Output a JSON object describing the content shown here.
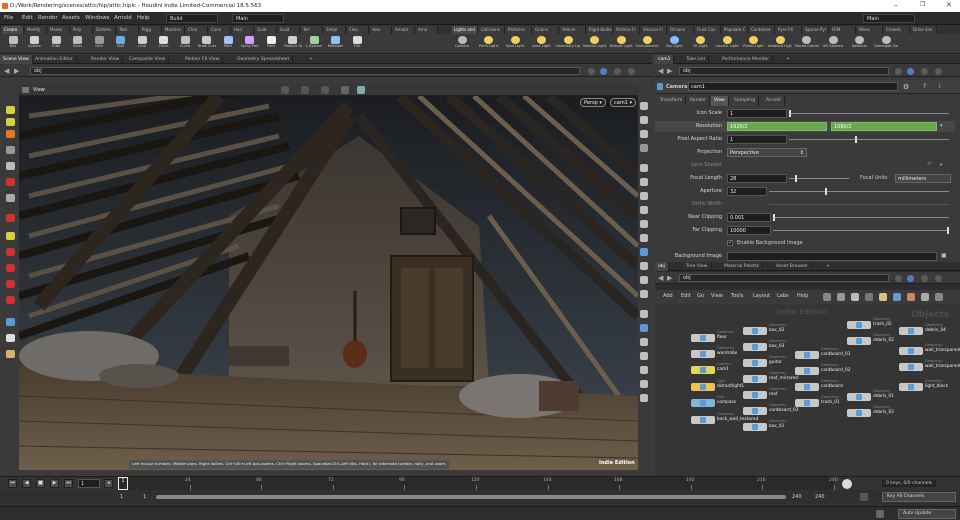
{
  "window": {
    "title": "D:/Work/Rendering/scenes/attic/hip/attic.hiplc - Houdini Indie Limited-Commercial 18.5.563"
  },
  "menu": {
    "items": [
      "File",
      "Edit",
      "Render",
      "Assets",
      "Windows",
      "Arnold",
      "Help"
    ],
    "build": "Build",
    "main_left": "Main",
    "main_right": "Main"
  },
  "shelf_tabs_left": [
    "Create",
    "Modify",
    "Model",
    "Poly",
    "Deform",
    "Text",
    "Rigg",
    "Muscles",
    "Char",
    "Cons",
    "Hair",
    "Guid",
    "Guid",
    "Terr",
    "Simpl",
    "Clou",
    "Volu",
    "Arnold",
    "Arno"
  ],
  "shelf_tabs_right": [
    "Lights and",
    "Collisions",
    "Particles",
    "Grains",
    "Vellum",
    "Rigid Bodies",
    "Particle Fl",
    "Viscous Fl",
    "Oceans",
    "Fluid Con",
    "Populate C",
    "Container",
    "Pyro FX",
    "Sparse Pyr",
    "FEM",
    "Wires",
    "Crowds",
    "Drive Sim"
  ],
  "tools_left": [
    "Box",
    "Sphere",
    "Tube",
    "Torus",
    "Grid",
    "Null",
    "Line",
    "Circle",
    "Curve",
    "Draw Curve",
    "Path",
    "Spray Paint",
    "Font",
    "Platonic Solids",
    "L-System",
    "Metaball",
    "File"
  ],
  "tools_right": [
    "Camera",
    "Point Light",
    "Spot Light",
    "Area Light",
    "Geometry Light",
    "Volume Light",
    "Distant Light",
    "Environment Light",
    "Sky Light",
    "GI Light",
    "Caustic Light",
    "Portal Light",
    "Ambient Light",
    "Stereo Camera",
    "VR Camera",
    "Switcher",
    "Gamepad Camera"
  ],
  "left_tabs": [
    "Scene View",
    "Animation Editor",
    "Render View",
    "Composite View",
    "Motion FX View",
    "Geometry Spreadsheet"
  ],
  "right_top_tabs": [
    "cam1",
    "Take List",
    "Performance Monitor"
  ],
  "right_bottom_tabs": [
    "obj",
    "Tree View",
    "Material Palette",
    "Asset Browser"
  ],
  "paths": {
    "viewport": "obj",
    "params": "obj",
    "network": "obj"
  },
  "viewport": {
    "label": "View",
    "persp": "Persp",
    "cam": "cam1",
    "hint": "Left mouse tumbles. Middle pans. Right dollies. Ctrl+Alt+Left box-zooms. Ctrl+Right zooms. Spacebar-Ctrl-Left tilts. Hold L for alternate tumble, dolly, and zoom.",
    "watermark": "Indie Edition"
  },
  "params": {
    "node_type": "Camera",
    "node_name": "cam1",
    "tabs": [
      "Transform",
      "Render",
      "View",
      "Sampling",
      "Arnold"
    ],
    "active_tab": "View",
    "icon_scale_label": "Icon Scale",
    "icon_scale": "1",
    "resolution_label": "Resolution",
    "res_x": "1920/2",
    "res_y": "1080/2",
    "pixel_aspect_label": "Pixel Aspect Ratio",
    "pixel_aspect": "1",
    "projection_label": "Projection",
    "projection": "Perspective",
    "lens_shader_label": "Lens Shader",
    "focal_length_label": "Focal Length",
    "focal_length": "28",
    "focal_units_label": "Focal Units",
    "focal_units": "millimeters",
    "aperture_label": "Aperture",
    "aperture": "32",
    "ortho_label": "Ortho Width",
    "near_label": "Near Clipping",
    "near": "0.001",
    "far_label": "Far Clipping",
    "far": "10000",
    "bg_enable_label": "Enable Background Image",
    "bg_image_label": "Background Image"
  },
  "network": {
    "menu": [
      "Add",
      "Edit",
      "Go",
      "View",
      "Tools",
      "Layout",
      "Labs",
      "Help"
    ],
    "watermark": "Indie Edition",
    "context_label": "Objects",
    "nodes": [
      {
        "type": "Geometry",
        "name": "floor"
      },
      {
        "type": "Geometry",
        "name": "wardrobe"
      },
      {
        "type": "Camera",
        "name": "cam1"
      },
      {
        "type": "Light",
        "name": "distantlight1"
      },
      {
        "type": "Null",
        "name": "compass"
      },
      {
        "type": "Geometry",
        "name": "back_wall_textured"
      },
      {
        "type": "Geometry",
        "name": "box_02"
      },
      {
        "type": "Geometry",
        "name": "box_03"
      },
      {
        "type": "Geometry",
        "name": "guitar"
      },
      {
        "type": "Geometry",
        "name": "roof_mirrored"
      },
      {
        "type": "Geometry",
        "name": "roof"
      },
      {
        "type": "Geometry",
        "name": "cardboard_03"
      },
      {
        "type": "Geometry",
        "name": "box_01"
      },
      {
        "type": "Geometry",
        "name": "cardboard_01"
      },
      {
        "type": "Geometry",
        "name": "cardboard_02"
      },
      {
        "type": "Geometry",
        "name": "cardboard"
      },
      {
        "type": "Geometry",
        "name": "trash_01"
      },
      {
        "type": "Geometry",
        "name": "trash_02"
      },
      {
        "type": "Geometry",
        "name": "debris_02"
      },
      {
        "type": "Geometry",
        "name": "debris_01"
      },
      {
        "type": "Geometry",
        "name": "debris_03"
      },
      {
        "type": "Geometry",
        "name": "debris_04"
      },
      {
        "type": "Geometry",
        "name": "wall_transparent_"
      },
      {
        "type": "Geometry",
        "name": "wall_transparent_"
      },
      {
        "type": "Geometry",
        "name": "light_block"
      }
    ]
  },
  "timeline": {
    "frame": "1",
    "ticks": [
      "24",
      "48",
      "72",
      "96",
      "120",
      "144",
      "168",
      "192",
      "216",
      "240"
    ],
    "start": "1",
    "start2": "1",
    "end": "240",
    "end2": "240",
    "keys_info": "0 keys, 0/0 channels",
    "channels": "Key All Channels",
    "auto_update": "Auto Update"
  }
}
